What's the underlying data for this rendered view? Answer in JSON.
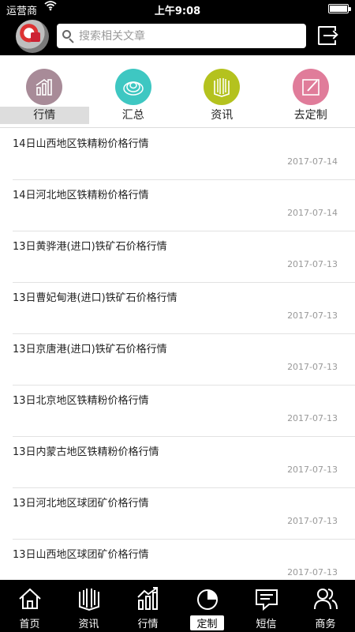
{
  "status_bar": {
    "carrier": "运营商",
    "time": "上午9:08"
  },
  "search": {
    "placeholder": "搜索相关文章"
  },
  "categories": [
    {
      "label": "行情",
      "icon": "chart-bars-icon",
      "color": "#a88b98",
      "active": true
    },
    {
      "label": "汇总",
      "icon": "summary-ring-icon",
      "color": "#3ec7c2",
      "active": false
    },
    {
      "label": "资讯",
      "icon": "news-book-icon",
      "color": "#b4c21e",
      "active": false
    },
    {
      "label": "去定制",
      "icon": "edit-pencil-icon",
      "color": "#e07c9a",
      "active": false
    }
  ],
  "articles": [
    {
      "title": "14日山西地区铁精粉价格行情",
      "date": "2017-07-14"
    },
    {
      "title": "14日河北地区铁精粉价格行情",
      "date": "2017-07-14"
    },
    {
      "title": "13日黄骅港(进口)铁矿石价格行情",
      "date": "2017-07-13"
    },
    {
      "title": "13日曹妃甸港(进口)铁矿石价格行情",
      "date": "2017-07-13"
    },
    {
      "title": "13日京唐港(进口)铁矿石价格行情",
      "date": "2017-07-13"
    },
    {
      "title": "13日北京地区铁精粉价格行情",
      "date": "2017-07-13"
    },
    {
      "title": "13日内蒙古地区铁精粉价格行情",
      "date": "2017-07-13"
    },
    {
      "title": "13日河北地区球团矿价格行情",
      "date": "2017-07-13"
    },
    {
      "title": "13日山西地区球团矿价格行情",
      "date": "2017-07-13"
    }
  ],
  "tabbar": [
    {
      "label": "首页",
      "icon": "home-icon",
      "active": false
    },
    {
      "label": "资讯",
      "icon": "news-book-icon",
      "active": false
    },
    {
      "label": "行情",
      "icon": "chart-trend-icon",
      "active": false
    },
    {
      "label": "定制",
      "icon": "pie-chart-icon",
      "active": true
    },
    {
      "label": "短信",
      "icon": "message-icon",
      "active": false
    },
    {
      "label": "商务",
      "icon": "people-icon",
      "active": false
    }
  ]
}
